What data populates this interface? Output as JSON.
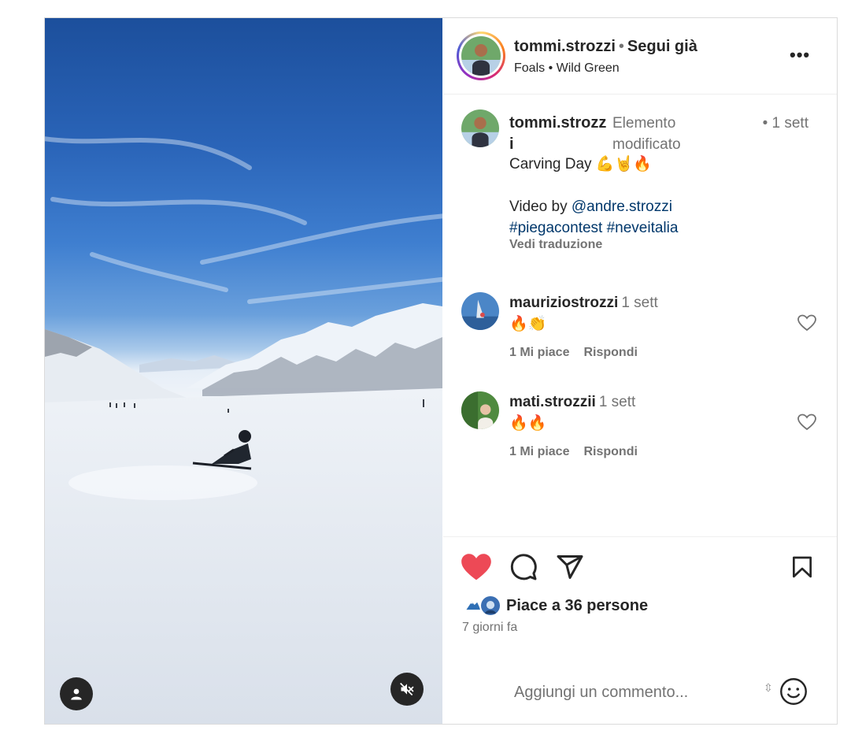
{
  "header": {
    "username": "tommi.strozzi",
    "separator": "•",
    "follow_status": "Segui già",
    "music": "Foals • Wild Green",
    "more_label": "•••"
  },
  "caption": {
    "username": "tommi.strozzi",
    "edited": "Elemento modificato",
    "time": "• 1 sett",
    "line1": "Carving Day 💪🤘🔥",
    "video_by": "Video by ",
    "mention": "@andre.strozzi",
    "hashtags": "#piegacontest #neveitalia",
    "translate": "Vedi traduzione"
  },
  "comments": [
    {
      "username": "mauriziostrozzi",
      "time": "1 sett",
      "text": "🔥👏",
      "likes": "1 Mi piace",
      "reply": "Rispondi"
    },
    {
      "username": "mati.strozzii",
      "time": "1 sett",
      "text": "🔥🔥",
      "likes": "1 Mi piace",
      "reply": "Rispondi"
    }
  ],
  "footer": {
    "likes_text": "Piace a 36 persone",
    "posted": "7 giorni fa",
    "liked": true,
    "accent": "#ed4956"
  },
  "add_comment": {
    "placeholder": "Aggiungi un commento...",
    "sort_icon": "⇳"
  },
  "icons": {
    "like": "heart-filled-icon",
    "comment": "speech-bubble-icon",
    "share": "paper-plane-icon",
    "save": "bookmark-icon",
    "emoji": "smiley-icon",
    "mute": "speaker-muted-icon",
    "tags": "user-tag-icon"
  }
}
